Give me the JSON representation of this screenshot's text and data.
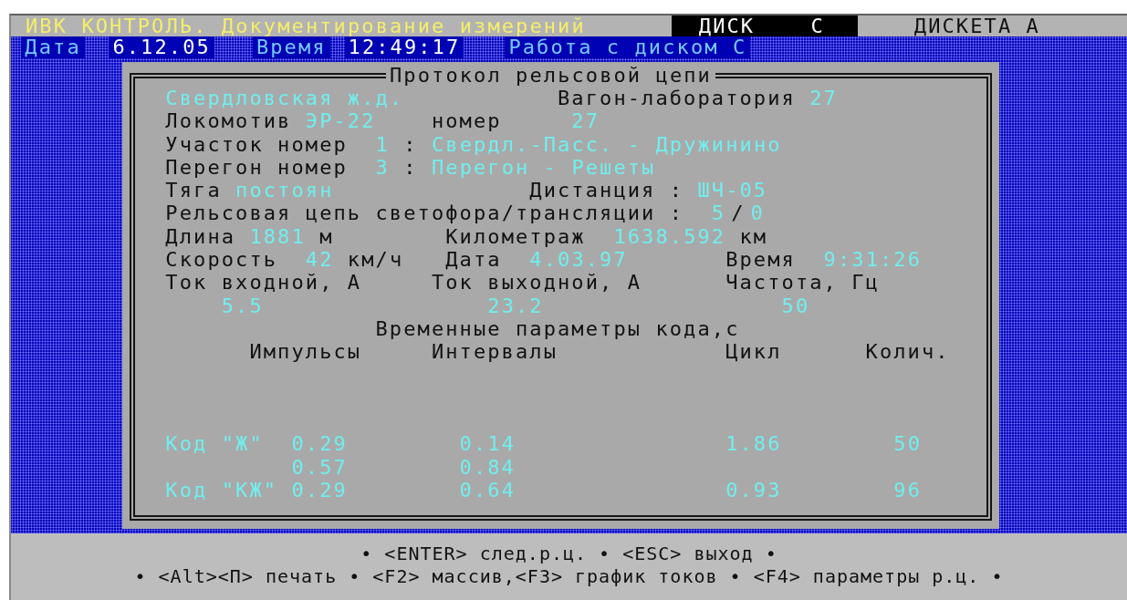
{
  "header": {
    "title": "ИВК КОНТРОЛЬ. Документирование измерений",
    "drives": [
      {
        "label": "ДИСК    C",
        "selected": true
      },
      {
        "label": "ДИСКЕТА A",
        "selected": false
      }
    ]
  },
  "status": [
    {
      "kind": "label",
      "text": "Дата"
    },
    {
      "kind": "value",
      "text": "6.12.05"
    },
    {
      "kind": "label",
      "text": "Время"
    },
    {
      "kind": "value",
      "text": "12:49:17"
    },
    {
      "kind": "label",
      "text": "Работа с диском С"
    }
  ],
  "protocol": {
    "title": "Протокол рельсовой цепи",
    "lines": [
      [
        {
          "kind": "value",
          "text": "Свердловская ж.д."
        },
        {
          "kind": "label",
          "text": "Вагон-лаборатория"
        },
        {
          "kind": "value",
          "text": "27"
        }
      ],
      [
        {
          "kind": "label",
          "text": "Локомотив"
        },
        {
          "kind": "value",
          "text": "ЭР-22"
        },
        {
          "kind": "label",
          "text": "номер"
        },
        {
          "kind": "value",
          "text": "27"
        }
      ],
      [
        {
          "kind": "label",
          "text": "Участок номер"
        },
        {
          "kind": "value",
          "text": "1"
        },
        {
          "kind": "label",
          "text": ":"
        },
        {
          "kind": "value",
          "text": "Свердл.-Пасс. - Дружинино"
        }
      ],
      [
        {
          "kind": "label",
          "text": "Перегон номер"
        },
        {
          "kind": "value",
          "text": "3"
        },
        {
          "kind": "label",
          "text": ":"
        },
        {
          "kind": "value",
          "text": "Перегон - Решеты"
        }
      ],
      [
        {
          "kind": "label",
          "text": "Тяга"
        },
        {
          "kind": "value",
          "text": "постоян"
        },
        {
          "kind": "label",
          "text": "Дистанция"
        },
        {
          "kind": "label",
          "text": ":"
        },
        {
          "kind": "value",
          "text": "ШЧ-05"
        }
      ],
      [
        {
          "kind": "label",
          "text": "Рельсовая цепь светофора/трансляции"
        },
        {
          "kind": "label",
          "text": ":"
        },
        {
          "kind": "value",
          "text": "5"
        },
        {
          "kind": "label",
          "text": "/"
        },
        {
          "kind": "value",
          "text": "0"
        }
      ],
      [
        {
          "kind": "label",
          "text": "Длина"
        },
        {
          "kind": "value",
          "text": "1881"
        },
        {
          "kind": "label",
          "text": "м"
        },
        {
          "kind": "label",
          "text": "Километраж"
        },
        {
          "kind": "value",
          "text": "1638.592"
        },
        {
          "kind": "label",
          "text": "км"
        }
      ],
      [
        {
          "kind": "label",
          "text": "Скорость"
        },
        {
          "kind": "value",
          "text": "42"
        },
        {
          "kind": "label",
          "text": "км/ч"
        },
        {
          "kind": "label",
          "text": "Дата"
        },
        {
          "kind": "value",
          "text": "4.03.97"
        },
        {
          "kind": "label",
          "text": "Время"
        },
        {
          "kind": "value",
          "text": "9:31:26"
        }
      ],
      [
        {
          "kind": "label",
          "text": "Ток входной, А"
        },
        {
          "kind": "label",
          "text": "Ток выходной, А"
        },
        {
          "kind": "label",
          "text": "Частота, Гц"
        }
      ],
      [
        {
          "kind": "value",
          "text": "5.5"
        },
        {
          "kind": "value",
          "text": "23.2"
        },
        {
          "kind": "value",
          "text": "50"
        }
      ]
    ],
    "code_table": {
      "title": "Временные параметры кода,с",
      "columns": [
        "Импульсы",
        "Интервалы",
        "Цикл",
        "Колич."
      ],
      "rows": [
        {
          "code": "Код \"Ж\"",
          "pulse": "0.29",
          "interval": "0.14",
          "cycle": "1.86",
          "count": "50"
        },
        {
          "pulse": "0.57",
          "interval": "0.84"
        },
        {
          "code": "Код \"КЖ\"",
          "pulse": "0.29",
          "interval": "0.64",
          "cycle": "0.93",
          "count": "96"
        }
      ]
    }
  },
  "hints": [
    "• <ENTER> след.р.ц. • <ESC> выход •",
    "• <Alt><П> печать • <F2> массив,<F3> график токов • <F4> параметры р.ц. •"
  ]
}
